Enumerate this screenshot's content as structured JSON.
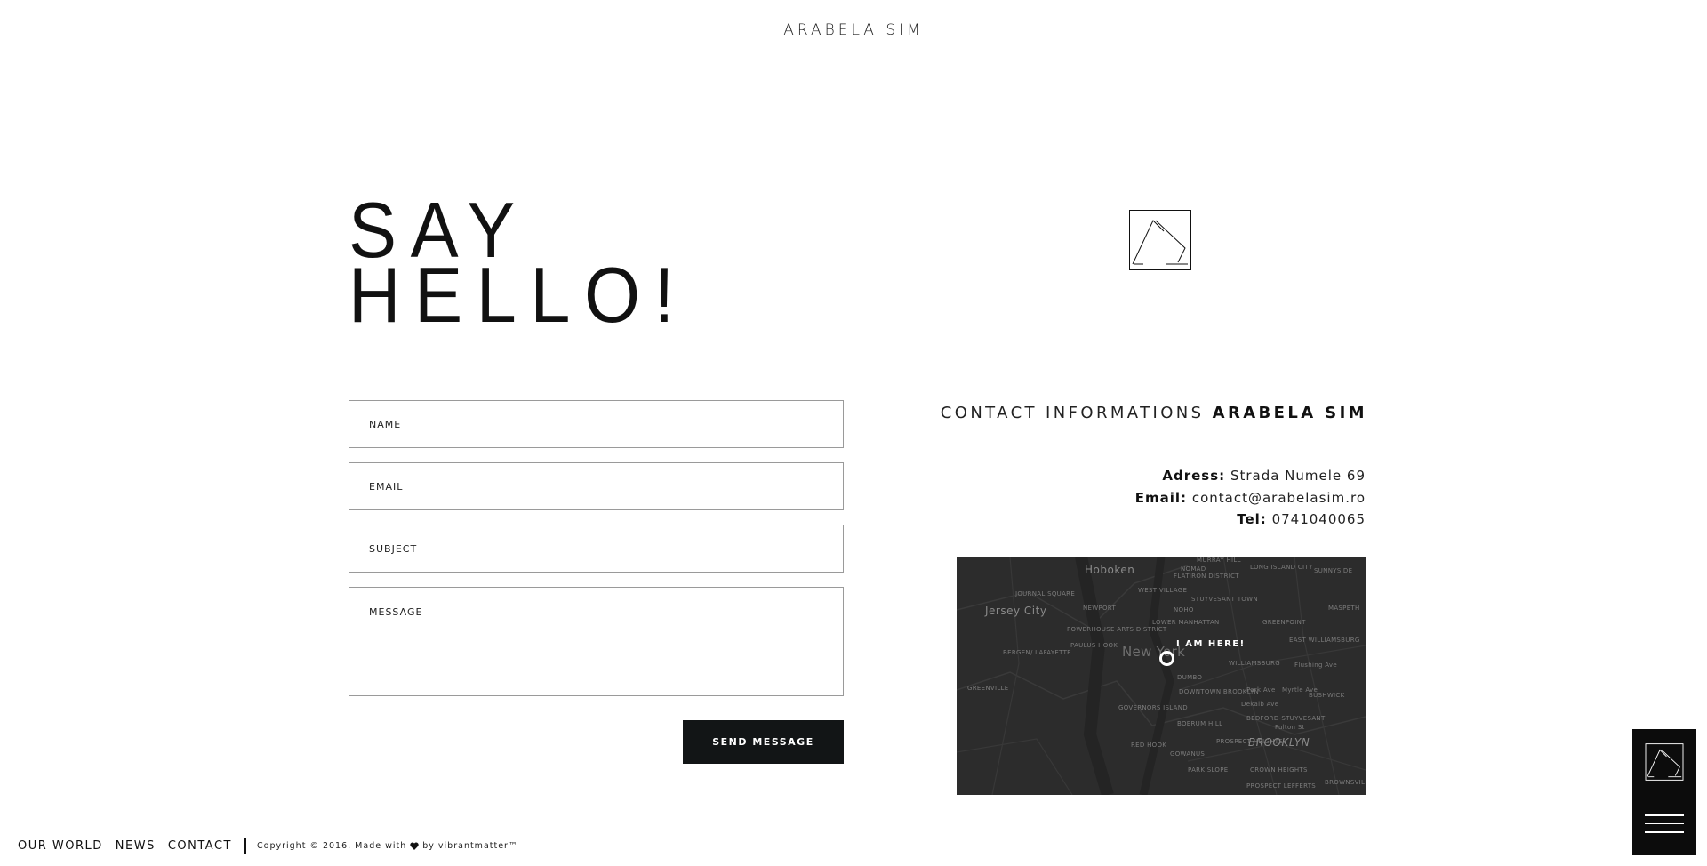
{
  "header": {
    "brand": "ARABELA SIM"
  },
  "hero": {
    "line1": "SAY",
    "line2": "HELLO!"
  },
  "form": {
    "name_placeholder": "NAME",
    "email_placeholder": "EMAIL",
    "subject_placeholder": "SUBJECT",
    "message_placeholder": "MESSAGE",
    "send_label": "SEND MESSAGE"
  },
  "contact": {
    "heading_light": "CONTACT INFORMATIONS",
    "heading_bold": "ARABELA SIM",
    "address_label": "Adress:",
    "address_value": "Strada Numele 69",
    "email_label": "Email:",
    "email_value": "contact@arabelasim.ro",
    "tel_label": "Tel:",
    "tel_value": "0741040065"
  },
  "map": {
    "marker_label": "I AM HERE!",
    "places": {
      "hoboken": "Hoboken",
      "jersey_city": "Jersey City",
      "new_york": "New York",
      "brooklyn": "BROOKLYN",
      "journal_square": "JOURNAL SQUARE",
      "newport": "NEWPORT",
      "west_village": "WEST VILLAGE",
      "noho": "NOHO",
      "stuyvesant_town": "STUYVESANT TOWN",
      "greenpoint": "GREENPOINT",
      "long_island_city": "LONG ISLAND CITY",
      "sunnyside": "SUNNYSIDE",
      "nomad": "NOMAD",
      "flatiron": "FLATIRON DISTRICT",
      "murray_hill": "MURRAY HILL",
      "powerhouse": "POWERHOUSE ARTS DISTRICT",
      "paulus_hook": "PAULUS HOOK",
      "lower_manhattan": "LOWER MANHATTAN",
      "bergen": "BERGEN/ LAFAYETTE",
      "williamsburg": "WILLIAMSBURG",
      "east_williamsburg": "EAST WILLIAMSBURG",
      "maspeth": "MASPETH",
      "dumbo": "DUMBO",
      "greenville": "GREENVILLE",
      "downtown_brooklyn": "DOWNTOWN BROOKLYN",
      "governors_island": "GOVERNORS ISLAND",
      "bushwick": "BUSHWICK",
      "bedford": "BEDFORD-STUYVESANT",
      "boerum_hill": "BOERUM HILL",
      "red_hook": "RED HOOK",
      "gowanus": "GOWANUS",
      "prospect_heights": "PROSPECT HEIGHTS",
      "park_slope": "PARK SLOPE",
      "crown_heights": "CROWN HEIGHTS",
      "prospect_lefferts": "PROSPECT LEFFERTS",
      "brownsville": "BROWNSVILLE",
      "park_ave": "Park Ave",
      "myrtle_ave": "Myrtle Ave",
      "dekalb_ave": "Dekalb Ave",
      "flushing_ave": "Flushing Ave",
      "fulton_st": "Fulton St"
    }
  },
  "footer": {
    "nav": [
      "OUR WORLD",
      "NEWS",
      "CONTACT"
    ],
    "copyright_prefix": "Copyright © 2016. Made with",
    "copyright_suffix": "by vibrantmatter™"
  },
  "colors": {
    "button_bg": "#121516",
    "map_bg": "#2c2c2c",
    "side_panel": "#0c0c0c"
  },
  "icons": {
    "logo": "arabela-logo-icon",
    "heart": "heart-icon",
    "menu": "hamburger-menu-icon",
    "pin": "map-pin-icon"
  }
}
